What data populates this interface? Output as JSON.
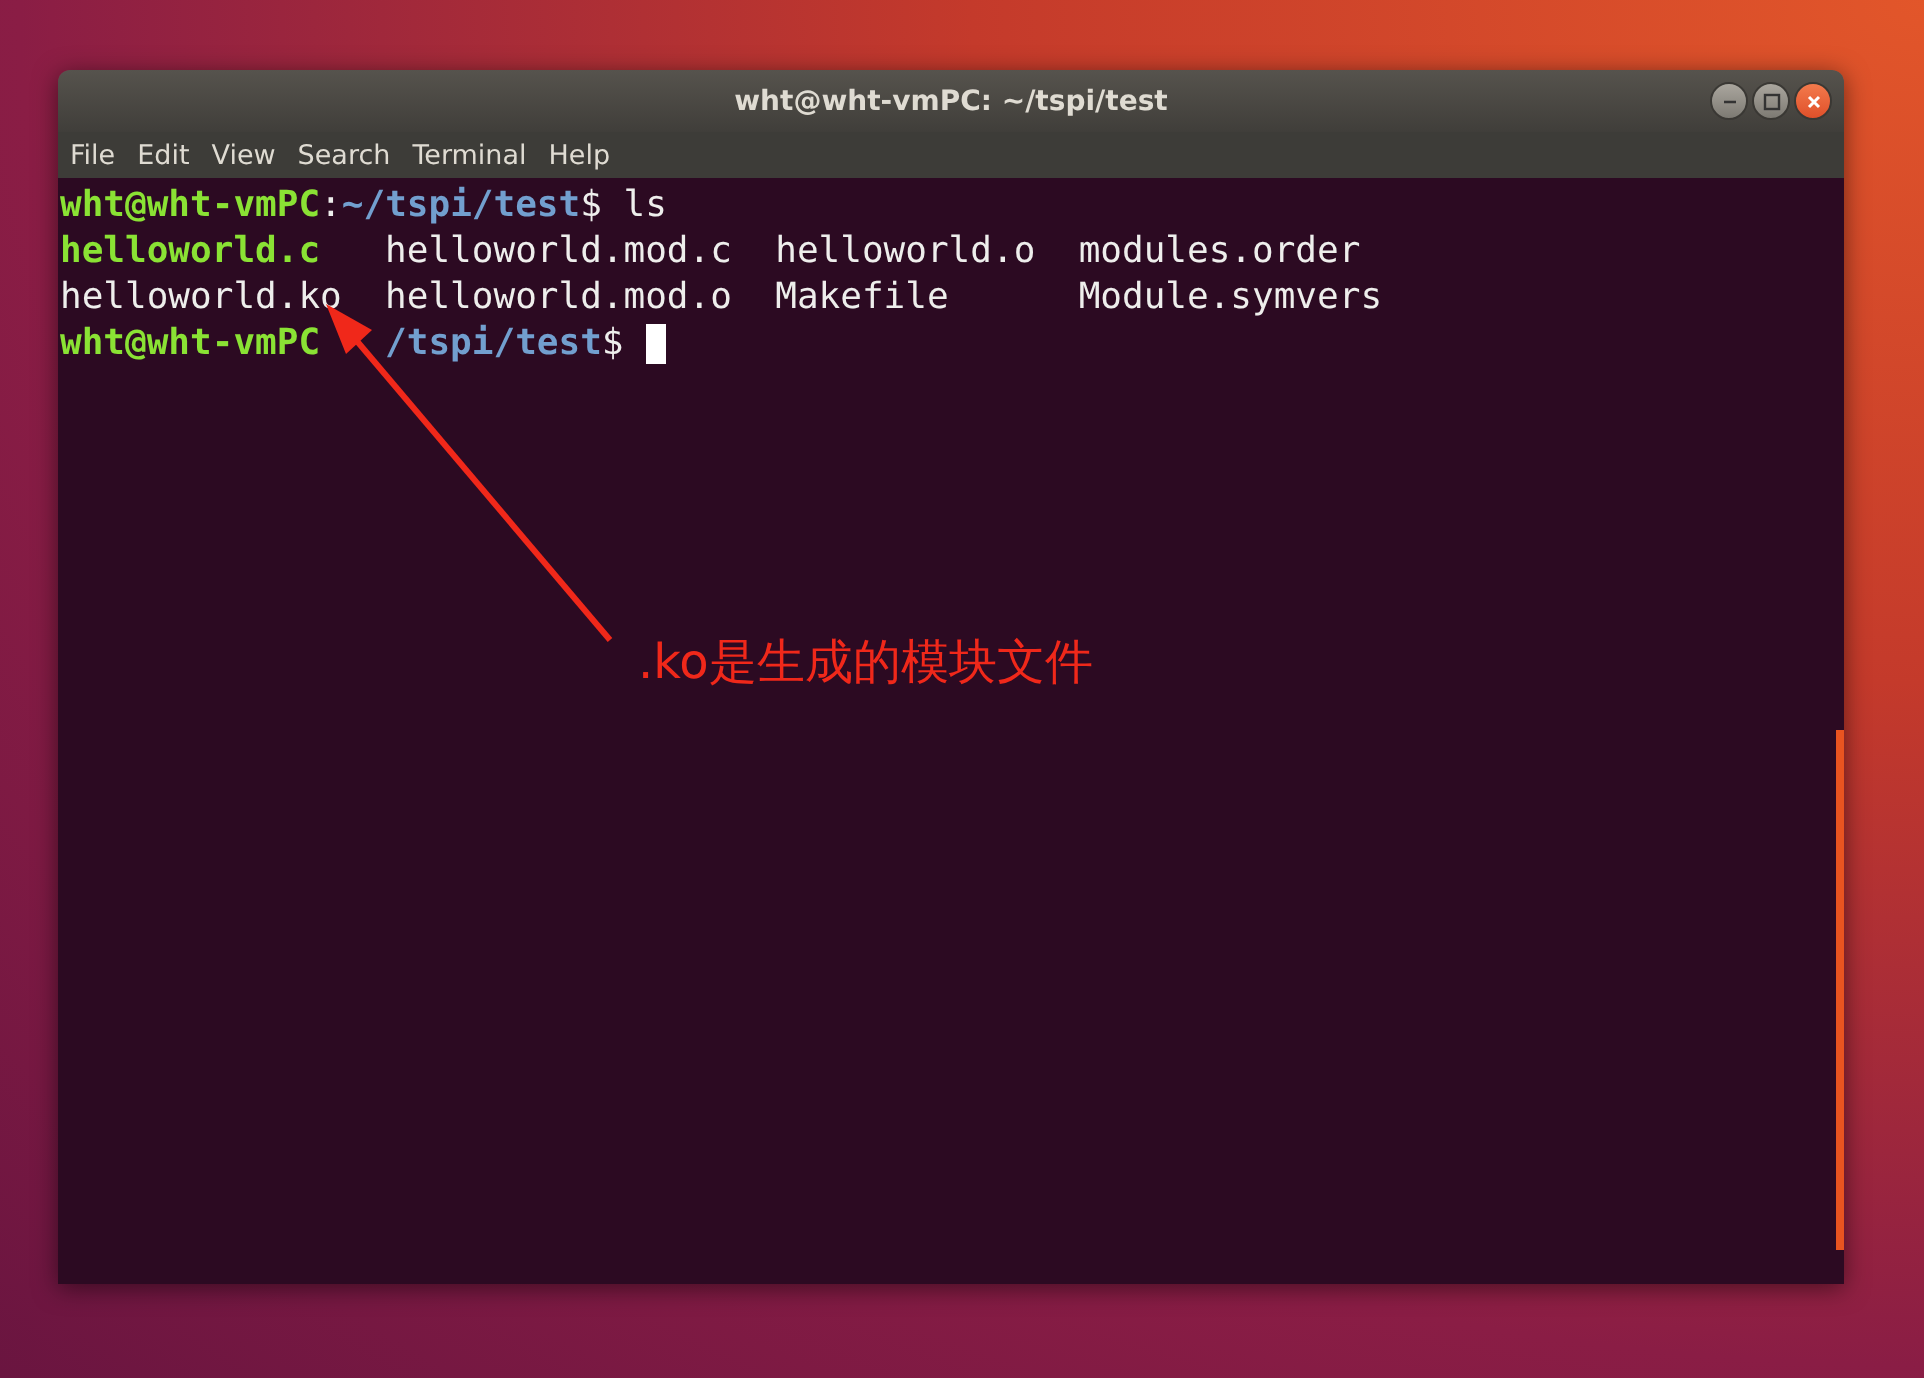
{
  "window": {
    "title": "wht@wht-vmPC: ~/tspi/test"
  },
  "menu": [
    {
      "label": "File"
    },
    {
      "label": "Edit"
    },
    {
      "label": "View"
    },
    {
      "label": "Search"
    },
    {
      "label": "Terminal"
    },
    {
      "label": "Help"
    }
  ],
  "terminal": {
    "lines": [
      {
        "kind": "prompt",
        "user": "wht@wht-vmPC",
        "sep": ":",
        "path": "~/tspi/test",
        "symbol": "$",
        "command": "ls",
        "cursor": false
      },
      {
        "kind": "listing",
        "files": [
          {
            "name": "helloworld.c",
            "kind": "executable"
          },
          {
            "name": "helloworld.mod.c",
            "kind": "regular"
          },
          {
            "name": "helloworld.o",
            "kind": "regular"
          },
          {
            "name": "modules.order",
            "kind": "regular"
          }
        ]
      },
      {
        "kind": "listing",
        "files": [
          {
            "name": "helloworld.ko",
            "kind": "regular"
          },
          {
            "name": "helloworld.mod.o",
            "kind": "regular"
          },
          {
            "name": "Makefile",
            "kind": "regular"
          },
          {
            "name": "Module.symvers",
            "kind": "regular"
          }
        ]
      },
      {
        "kind": "prompt",
        "user": "wht@wht-vmPC",
        "path": "/tspi/test",
        "symbol": "$",
        "cursor": true
      }
    ]
  },
  "annotation": {
    "text": ".ko是生成的模块文件"
  }
}
